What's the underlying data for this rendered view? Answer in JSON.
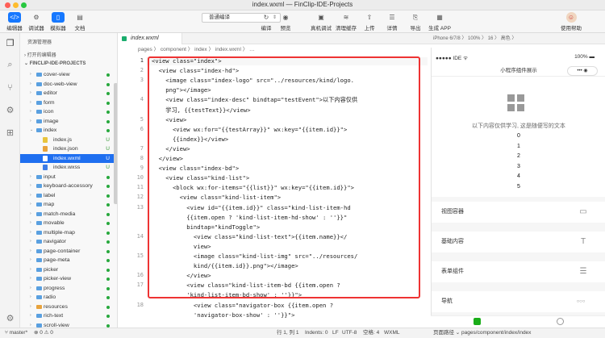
{
  "window": {
    "title": "index.wxml — FinClip-IDE-Projects"
  },
  "toolbar": {
    "left": [
      {
        "label": "编辑器",
        "icon": "code-icon"
      },
      {
        "label": "调试器",
        "icon": "debug-icon"
      },
      {
        "label": "模拟器",
        "icon": "phone-icon"
      },
      {
        "label": "文档",
        "icon": "doc-icon"
      }
    ],
    "compile_select": "普通编译",
    "center": [
      {
        "label": "编译",
        "icon": "refresh-icon"
      },
      {
        "label": "预览",
        "icon": "eye-icon"
      },
      {
        "label": "真机调试",
        "icon": "device-icon"
      },
      {
        "label": "清理缓存",
        "icon": "clear-icon"
      },
      {
        "label": "上传",
        "icon": "upload-icon"
      },
      {
        "label": "详情",
        "icon": "detail-icon"
      },
      {
        "label": "导出",
        "icon": "export-icon"
      },
      {
        "label": "生成 APP",
        "icon": "app-icon"
      }
    ],
    "right": {
      "label": "使用帮助"
    }
  },
  "explorer": {
    "header": "资源管理器",
    "open_editors": "打开的编辑器",
    "project": "FINCLIP-IDE-PROJECTS",
    "items": [
      {
        "name": "cover-view",
        "type": "folder",
        "level": 1,
        "status": "dot"
      },
      {
        "name": "doc-web-view",
        "type": "folder",
        "level": 1,
        "status": "dot"
      },
      {
        "name": "editor",
        "type": "folder",
        "level": 1,
        "status": "dot"
      },
      {
        "name": "form",
        "type": "folder",
        "level": 1,
        "status": "dot"
      },
      {
        "name": "icon",
        "type": "folder",
        "level": 1,
        "status": "dot"
      },
      {
        "name": "image",
        "type": "folder",
        "level": 1,
        "status": "dot"
      },
      {
        "name": "index",
        "type": "folder",
        "level": 1,
        "status": "dot",
        "open": true
      },
      {
        "name": "index.js",
        "type": "js",
        "level": 2,
        "status": "U"
      },
      {
        "name": "index.json",
        "type": "json",
        "level": 2,
        "status": "U"
      },
      {
        "name": "index.wxml",
        "type": "wxml",
        "level": 2,
        "status": "U",
        "selected": true
      },
      {
        "name": "index.wxss",
        "type": "wxss",
        "level": 2,
        "status": "U"
      },
      {
        "name": "input",
        "type": "folder",
        "level": 1,
        "status": "dot"
      },
      {
        "name": "keyboard-accessory",
        "type": "folder",
        "level": 1,
        "status": "dot"
      },
      {
        "name": "label",
        "type": "folder",
        "level": 1,
        "status": "dot"
      },
      {
        "name": "map",
        "type": "folder",
        "level": 1,
        "status": "dot"
      },
      {
        "name": "match-media",
        "type": "folder",
        "level": 1,
        "status": "dot"
      },
      {
        "name": "movable",
        "type": "folder",
        "level": 1,
        "status": "dot"
      },
      {
        "name": "multiple-map",
        "type": "folder",
        "level": 1,
        "status": "dot"
      },
      {
        "name": "navigator",
        "type": "folder",
        "level": 1,
        "status": "dot"
      },
      {
        "name": "page-container",
        "type": "folder",
        "level": 1,
        "status": "dot"
      },
      {
        "name": "page-meta",
        "type": "folder",
        "level": 1,
        "status": "dot"
      },
      {
        "name": "picker",
        "type": "folder",
        "level": 1,
        "status": "dot"
      },
      {
        "name": "picker-view",
        "type": "folder",
        "level": 1,
        "status": "dot"
      },
      {
        "name": "progress",
        "type": "folder",
        "level": 1,
        "status": "dot"
      },
      {
        "name": "radio",
        "type": "folder",
        "level": 1,
        "status": "dot"
      },
      {
        "name": "resources",
        "type": "folder",
        "level": 1,
        "status": "dot",
        "color": "#e8a33d"
      },
      {
        "name": "rich-text",
        "type": "folder",
        "level": 1,
        "status": "dot"
      },
      {
        "name": "scroll-view",
        "type": "folder",
        "level": 1,
        "status": "dot"
      }
    ]
  },
  "editor": {
    "tab": "index.wxml",
    "breadcrumb": "pages 〉 component 〉 index 〉 index.wxml 〉 …",
    "lines": [
      {
        "n": "1",
        "text": "<view class=\"index\">",
        "cur": true
      },
      {
        "n": "2",
        "text": "  <view class=\"index-hd\">"
      },
      {
        "n": "3",
        "text": "    <image class=\"index-logo\" src=\"../resources/kind/logo."
      },
      {
        "n": "",
        "text": "    png\"></image>"
      },
      {
        "n": "4",
        "text": "    <view class=\"index-desc\" bindtap=\"testEvent\">以下内容仅供"
      },
      {
        "n": "",
        "text": "    学习, {{testText}}</view>"
      },
      {
        "n": "5",
        "text": "    <view>"
      },
      {
        "n": "6",
        "text": "      <view wx:for=\"{{testArray}}\" wx:key=\"{{item.id}}\">"
      },
      {
        "n": "",
        "text": "      {{index}}</view>"
      },
      {
        "n": "7",
        "text": "    </view>"
      },
      {
        "n": "8",
        "text": "  </view>"
      },
      {
        "n": "9",
        "text": "  <view class=\"index-bd\">"
      },
      {
        "n": "10",
        "text": "    <view class=\"kind-list\">"
      },
      {
        "n": "11",
        "text": "      <block wx:for-items=\"{{list}}\" wx:key=\"{{item.id}}\">"
      },
      {
        "n": "12",
        "text": "        <view class=\"kind-list-item\">"
      },
      {
        "n": "13",
        "text": "          <view id=\"{{item.id}}\" class=\"kind-list-item-hd"
      },
      {
        "n": "",
        "text": "          {{item.open ? 'kind-list-item-hd-show' : ''}}\""
      },
      {
        "n": "",
        "text": "          bindtap=\"kindToggle\">"
      },
      {
        "n": "14",
        "text": "            <view class=\"kind-list-text\">{{item.name}}</"
      },
      {
        "n": "",
        "text": "            view>"
      },
      {
        "n": "15",
        "text": "            <image class=\"kind-list-img\" src=\"../resources/"
      },
      {
        "n": "",
        "text": "            kind/{{item.id}}.png\"></image>"
      },
      {
        "n": "16",
        "text": "          </view>"
      },
      {
        "n": "17",
        "text": "          <view class=\"kind-list-item-bd {{item.open ?"
      },
      {
        "n": "",
        "text": "          'kind-list-item-bd-show' : ''}}\">"
      },
      {
        "n": "18",
        "text": "            <view class=\"navigator-box {{item.open ?"
      },
      {
        "n": "",
        "text": "            'navigator-box-show' : ''}}\">"
      }
    ]
  },
  "simulator": {
    "device_bar": "iPhone 6/7/8  〉  100%  〉  16  〉  高色  〉",
    "status_left": "●●●●● IDE ᯤ",
    "status_right": "100% ▬",
    "nav_title": "小程序组件展示",
    "capsule": "•••  ◉",
    "desc": "以下内容仅供学习, 这是随便写的文本",
    "numbers": [
      "0",
      "1",
      "2",
      "3",
      "4",
      "5"
    ],
    "kinds": [
      {
        "label": "视图容器",
        "icon": "container-icon"
      },
      {
        "label": "基础内容",
        "icon": "text-icon"
      },
      {
        "label": "表单组件",
        "icon": "form-icon"
      },
      {
        "label": "导航",
        "icon": "more-icon"
      }
    ],
    "path": "页面路径 ⌄   pages/component/index/index"
  },
  "statusbar": {
    "branch": "master*",
    "errors": "⊗ 0 ⚠ 0",
    "position": "行 1, 列 1",
    "indent": "Indents: 0",
    "eol": "LF",
    "encoding": "UTF-8",
    "spaces": "空格: 4",
    "lang": "WXML"
  },
  "colors": {
    "accent": "#1678ff",
    "highlight": "#e33333",
    "selected": "#1f6ff0",
    "git_green": "#27a83d"
  }
}
